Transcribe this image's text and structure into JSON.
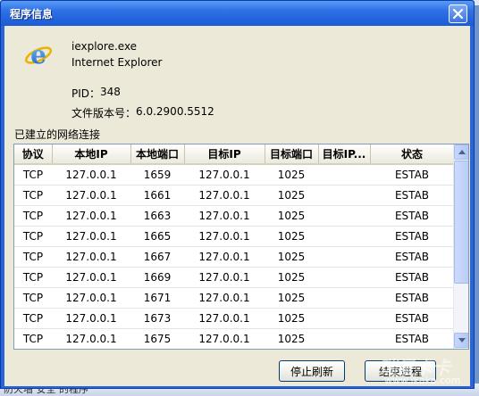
{
  "window": {
    "title": "程序信息"
  },
  "process": {
    "name": "iexplore.exe",
    "app_name": "Internet Explorer",
    "pid_label": "PID：",
    "pid": "348",
    "version_label": "文件版本号：",
    "version": "6.0.2900.5512"
  },
  "connections": {
    "label": "已建立的网络连接",
    "columns": [
      "协议",
      "本地IP",
      "本地端口",
      "目标IP",
      "目标端口",
      "目标IP...",
      "状态"
    ],
    "rows": [
      [
        "TCP",
        "127.0.0.1",
        "1659",
        "127.0.0.1",
        "1025",
        "",
        "ESTAB"
      ],
      [
        "TCP",
        "127.0.0.1",
        "1661",
        "127.0.0.1",
        "1025",
        "",
        "ESTAB"
      ],
      [
        "TCP",
        "127.0.0.1",
        "1663",
        "127.0.0.1",
        "1025",
        "",
        "ESTAB"
      ],
      [
        "TCP",
        "127.0.0.1",
        "1665",
        "127.0.0.1",
        "1025",
        "",
        "ESTAB"
      ],
      [
        "TCP",
        "127.0.0.1",
        "1667",
        "127.0.0.1",
        "1025",
        "",
        "ESTAB"
      ],
      [
        "TCP",
        "127.0.0.1",
        "1669",
        "127.0.0.1",
        "1025",
        "",
        "ESTAB"
      ],
      [
        "TCP",
        "127.0.0.1",
        "1671",
        "127.0.0.1",
        "1025",
        "",
        "ESTAB"
      ],
      [
        "TCP",
        "127.0.0.1",
        "1673",
        "127.0.0.1",
        "1025",
        "",
        "ESTAB"
      ],
      [
        "TCP",
        "127.0.0.1",
        "1675",
        "127.0.0.1",
        "1025",
        "",
        "ESTAB"
      ]
    ]
  },
  "buttons": {
    "stop_refresh": "停止刷新",
    "end_process": "结束进程"
  },
  "background": {
    "bottom_text": "防火墙 安全 的程序"
  },
  "watermark": {
    "brand": "瑞星卡卡",
    "url": "www.ikaka.com"
  },
  "icons": {
    "app": "internet-explorer-icon",
    "close": "close-icon",
    "scroll_up": "scroll-up-arrow-icon",
    "scroll_down": "scroll-down-arrow-icon"
  },
  "colors": {
    "titlebar": "#2e70e6",
    "client_bg": "#ece9d8",
    "watermark_text": "#ffffff"
  }
}
